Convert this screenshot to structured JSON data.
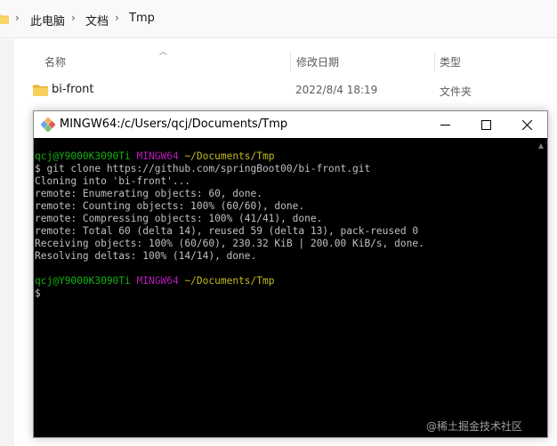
{
  "explorer": {
    "breadcrumb": [
      "此电脑",
      "文档",
      "Tmp"
    ],
    "columns": {
      "name": "名称",
      "modified": "修改日期",
      "type": "类型"
    },
    "files": [
      {
        "name": "bi-front",
        "modified": "2022/8/4 18:19",
        "type": "文件夹"
      }
    ]
  },
  "terminal": {
    "title": "MINGW64:/c/Users/qcj/Documents/Tmp",
    "prompt1": {
      "user": "qcj@Y9000K3090Ti",
      "env": "MINGW64",
      "path": "~/Documents/Tmp"
    },
    "command": "$ git clone https://github.com/springBoot00/bi-front.git",
    "output": [
      "Cloning into 'bi-front'...",
      "remote: Enumerating objects: 60, done.",
      "remote: Counting objects: 100% (60/60), done.",
      "remote: Compressing objects: 100% (41/41), done.",
      "remote: Total 60 (delta 14), reused 59 (delta 13), pack-reused 0",
      "Receiving objects: 100% (60/60), 230.32 KiB | 200.00 KiB/s, done.",
      "Resolving deltas: 100% (14/14), done."
    ],
    "prompt2": {
      "user": "qcj@Y9000K3090Ti",
      "env": "MINGW64",
      "path": "~/Documents/Tmp"
    },
    "cursor": "$"
  },
  "watermark": "@稀土掘金技术社区",
  "colors": {
    "user": "#12b212",
    "env": "#b81bb8",
    "path": "#c4b822",
    "text": "#c0c0c0",
    "folder": "#f2c14e"
  },
  "icons": [
    "folder-icon",
    "mingw-icon",
    "minimize-icon",
    "maximize-icon",
    "close-icon",
    "chevron-right-icon",
    "sort-up-icon"
  ]
}
